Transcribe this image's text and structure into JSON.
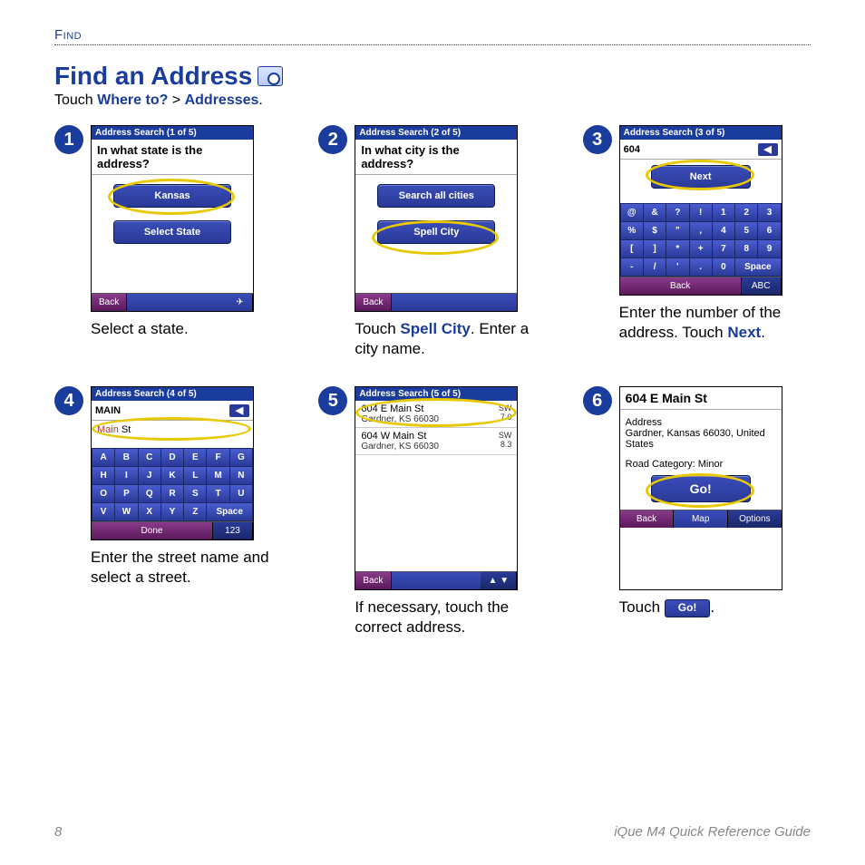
{
  "section_label": "Find",
  "title": "Find an Address",
  "subtitle_prefix": "Touch ",
  "subtitle_link1": "Where to?",
  "subtitle_sep": " > ",
  "subtitle_link2": "Addresses",
  "subtitle_period": ".",
  "steps": [
    {
      "num": "1",
      "screen_title": "Address Search  (1 of 5)",
      "prompt": "In what state is the address?",
      "buttons": [
        "Kansas",
        "Select State"
      ],
      "back": "Back",
      "caption": "Select a state."
    },
    {
      "num": "2",
      "screen_title": "Address Search  (2 of 5)",
      "prompt": "In what city is the address?",
      "buttons": [
        "Search all cities",
        "Spell City"
      ],
      "back": "Back",
      "caption_prefix": "Touch ",
      "caption_bold": "Spell City",
      "caption_suffix": ". Enter a city name."
    },
    {
      "num": "3",
      "screen_title": "Address Search  (3 of 5)",
      "input": "604",
      "next": "Next",
      "keypad": {
        "row1": [
          "@",
          "&",
          "?",
          "!",
          "1",
          "2",
          "3"
        ],
        "row2": [
          "%",
          "$",
          "\"",
          ",",
          "4",
          "5",
          "6"
        ],
        "row3": [
          "[",
          "]",
          "*",
          "+",
          "7",
          "8",
          "9"
        ],
        "row4": [
          "-",
          "/",
          "'",
          ".",
          "0",
          "Space"
        ]
      },
      "back": "Back",
      "abc": "ABC",
      "caption_prefix": "Enter the number of the address. Touch ",
      "caption_bold": "Next",
      "caption_suffix": "."
    },
    {
      "num": "4",
      "screen_title": "Address Search  (4 of 5)",
      "input": "MAIN",
      "suggestion_hl": "Main",
      "suggestion_rest": " St",
      "keyboard": {
        "row1": [
          "A",
          "B",
          "C",
          "D",
          "E",
          "F",
          "G"
        ],
        "row2": [
          "H",
          "I",
          "J",
          "K",
          "L",
          "M",
          "N"
        ],
        "row3": [
          "O",
          "P",
          "Q",
          "R",
          "S",
          "T",
          "U"
        ],
        "row4": [
          "V",
          "W",
          "X",
          "Y",
          "Z",
          "Space"
        ]
      },
      "done": "Done",
      "mode123": "123",
      "caption": "Enter the street name and select a street."
    },
    {
      "num": "5",
      "screen_title": "Address Search  (5 of 5)",
      "results": [
        {
          "line1": "604 E Main St",
          "line2": "Gardner, KS 66030",
          "dir": "SW",
          "dist": "7.0"
        },
        {
          "line1": "604 W Main St",
          "line2": "Gardner, KS 66030",
          "dir": "SW",
          "dist": "8.3"
        }
      ],
      "back": "Back",
      "caption": "If necessary, touch the correct address."
    },
    {
      "num": "6",
      "result_title": "604 E Main St",
      "addr_label": "Address",
      "addr_line": "Gardner, Kansas 66030, United States",
      "road_cat": "Road Category: Minor",
      "go": "Go!",
      "back": "Back",
      "map": "Map",
      "options": "Options",
      "caption_prefix": "Touch ",
      "caption_go": "Go!",
      "caption_suffix": "."
    }
  ],
  "footer": {
    "page": "8",
    "guide": "iQue M4 Quick Reference Guide"
  }
}
